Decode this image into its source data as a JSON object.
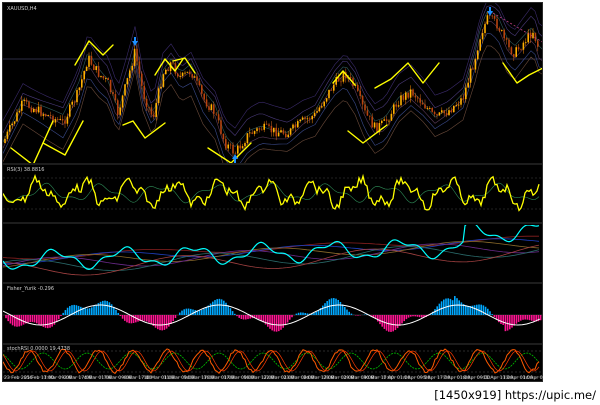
{
  "window": {
    "symbol_label": "XAUUSD,H4",
    "watermark": "[1450x919] https://upic.me/"
  },
  "panes": [
    {
      "id": "price",
      "label": "XAUUSD,H4"
    },
    {
      "id": "rsi",
      "label": "RSI(3) 38.8816"
    },
    {
      "id": "ma_band",
      "label": ""
    },
    {
      "id": "fisher",
      "label": "Fisher_Yurik -0.296"
    },
    {
      "id": "stoch",
      "label": "stochRSI 0.0000 19.4738"
    }
  ],
  "time_axis": {
    "ticks": [
      "23 Feb 2016",
      "25 Feb 17:00",
      "1 Mar 09:00",
      "2 Mar 17:00",
      "4 Mar 01:00",
      "7 Mar 09:00",
      "8 Mar 17:00",
      "10 Mar 01:00",
      "11 Mar 09:00",
      "14 Mar 17:00",
      "16 Mar 01:00",
      "17 Mar 09:00",
      "18 Mar 17:00",
      "22 Mar 01:00",
      "23 Mar 09:00",
      "24 Mar 17:00",
      "28 Mar 01:00",
      "29 Mar 09:00",
      "30 Mar 17:00",
      "1 Apr 01:00",
      "4 Apr 09:00",
      "5 Apr 17:00",
      "7 Apr 01:00",
      "8 Apr 09:00",
      "11 Apr 17:00",
      "13 Apr 01:00",
      "14 Apr 09:00"
    ]
  },
  "colors": {
    "background": "#000000",
    "candle_up": "#ff8c00",
    "candle_down": "#d2691e",
    "rsi_line": "#ffff00",
    "cyan_line": "#00ffff",
    "fisher_pos": "#00a8ff",
    "fisher_neg": "#ff1493",
    "annotation": "#ffff00",
    "arrow_marker": "#1e90ff",
    "stoch_orange": "#ff5a00",
    "stoch_green": "#00c000"
  },
  "markers": [
    {
      "name": "down-arrow-icon"
    },
    {
      "name": "up-arrow-icon"
    },
    {
      "name": "down-arrow-icon"
    }
  ]
}
